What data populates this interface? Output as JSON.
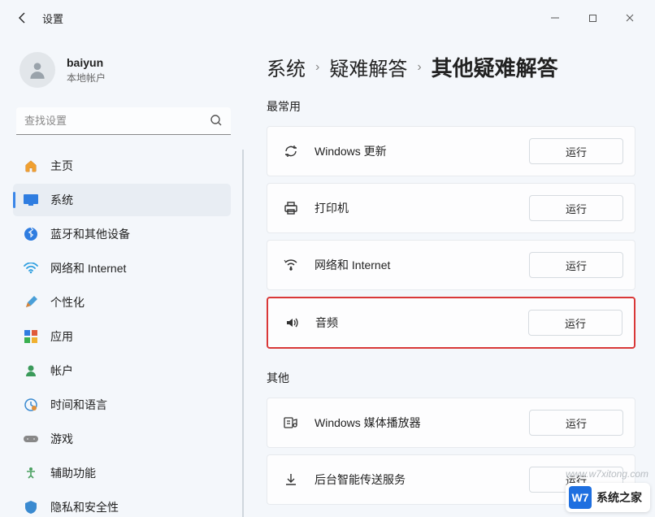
{
  "window": {
    "title": "设置"
  },
  "user": {
    "name": "baiyun",
    "subtitle": "本地帐户"
  },
  "search": {
    "placeholder": "查找设置"
  },
  "nav": {
    "items": [
      {
        "icon": "home",
        "label": "主页"
      },
      {
        "icon": "system",
        "label": "系统"
      },
      {
        "icon": "bluetooth",
        "label": "蓝牙和其他设备"
      },
      {
        "icon": "network",
        "label": "网络和 Internet"
      },
      {
        "icon": "personalize",
        "label": "个性化"
      },
      {
        "icon": "apps",
        "label": "应用"
      },
      {
        "icon": "accounts",
        "label": "帐户"
      },
      {
        "icon": "time",
        "label": "时间和语言"
      },
      {
        "icon": "gaming",
        "label": "游戏"
      },
      {
        "icon": "accessibility",
        "label": "辅助功能"
      },
      {
        "icon": "privacy",
        "label": "隐私和安全性"
      }
    ],
    "selected_index": 1
  },
  "breadcrumb": {
    "items": [
      "系统",
      "疑难解答",
      "其他疑难解答"
    ]
  },
  "sections": {
    "frequent": {
      "title": "最常用",
      "items": [
        {
          "icon": "sync",
          "label": "Windows 更新",
          "button": "运行"
        },
        {
          "icon": "printer",
          "label": "打印机",
          "button": "运行"
        },
        {
          "icon": "wifi",
          "label": "网络和 Internet",
          "button": "运行"
        },
        {
          "icon": "audio",
          "label": "音频",
          "button": "运行",
          "highlighted": true
        }
      ]
    },
    "other": {
      "title": "其他",
      "items": [
        {
          "icon": "media",
          "label": "Windows 媒体播放器",
          "button": "运行"
        },
        {
          "icon": "download",
          "label": "后台智能传送服务",
          "button": "运行"
        }
      ]
    }
  },
  "watermark": "www.w7xitong.com",
  "logo": {
    "badge": "W7",
    "text": "系统之家"
  }
}
